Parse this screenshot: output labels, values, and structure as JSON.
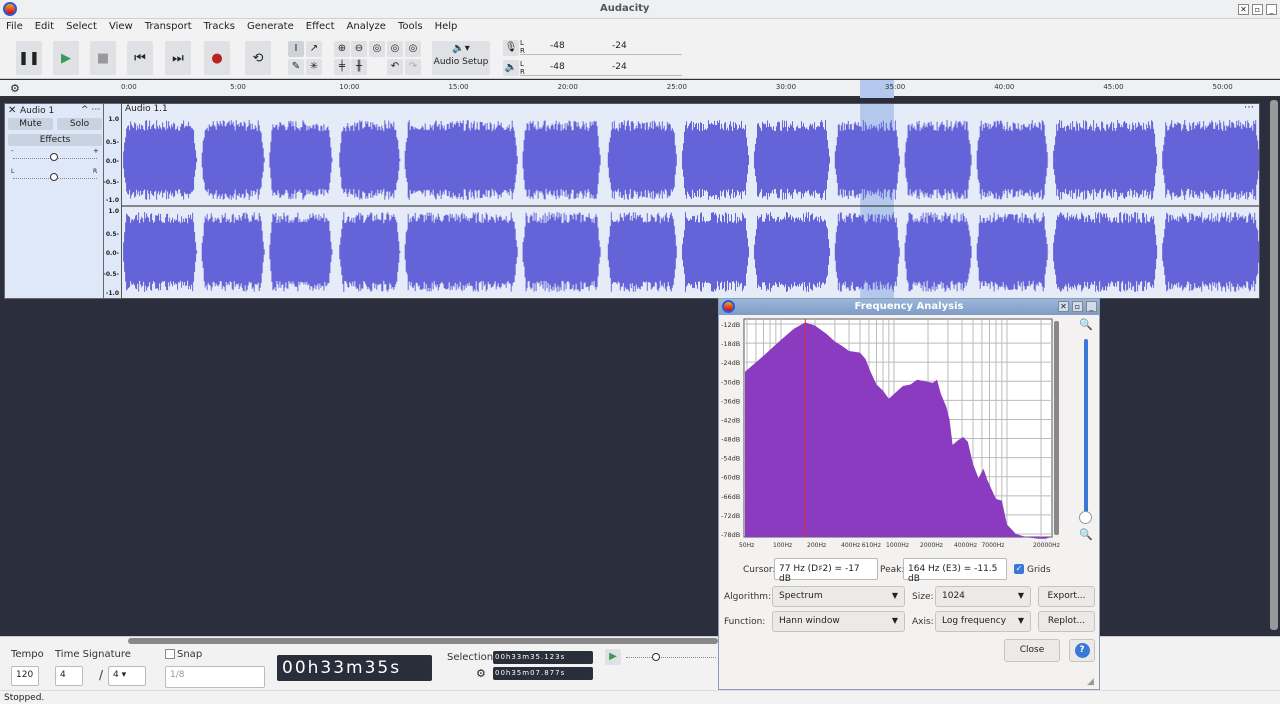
{
  "app": {
    "title": "Audacity"
  },
  "menu": [
    "File",
    "Edit",
    "Select",
    "View",
    "Transport",
    "Tracks",
    "Generate",
    "Effect",
    "Analyze",
    "Tools",
    "Help"
  ],
  "toolbar": {
    "audio_setup": "Audio Setup",
    "meter_rec": {
      "l": "L",
      "r": "R",
      "ticks": [
        "-48",
        "-24"
      ]
    },
    "meter_play": {
      "l": "L",
      "r": "R",
      "ticks": [
        "-48",
        "-24"
      ]
    }
  },
  "ruler": {
    "labels": [
      "0:00",
      "5:00",
      "10:00",
      "15:00",
      "20:00",
      "25:00",
      "30:00",
      "35:00",
      "40:00",
      "45:00",
      "50:00"
    ]
  },
  "track": {
    "name": "Audio 1",
    "clip_name": "Audio 1.1",
    "mute": "Mute",
    "solo": "Solo",
    "effects": "Effects",
    "gain_minus": "-",
    "gain_plus": "+",
    "pan_l": "L",
    "pan_r": "R",
    "scale": [
      "1.0",
      "0.5-",
      "0.0-",
      "-0.5-",
      "-1.0"
    ],
    "selection_min": [
      33.585,
      35.131
    ],
    "clips_min": [
      [
        -0.2,
        3.2
      ],
      [
        3.4,
        6.3
      ],
      [
        6.5,
        9.4
      ],
      [
        9.7,
        12.5
      ],
      [
        12.7,
        17.9
      ],
      [
        18.1,
        21.7
      ],
      [
        22.0,
        25.2
      ],
      [
        25.4,
        28.5
      ],
      [
        28.7,
        32.2
      ],
      [
        32.4,
        35.4
      ],
      [
        35.6,
        38.7
      ],
      [
        38.9,
        42.2
      ],
      [
        42.4,
        47.2
      ],
      [
        47.4,
        51.9
      ]
    ]
  },
  "bottom": {
    "tempo_label": "Tempo",
    "tempo": "120",
    "timesig_label": "Time Signature",
    "ts_num": "4",
    "ts_sep": "/",
    "ts_den": "4",
    "snap_label": "Snap",
    "snap_value": "1/8",
    "time": "00h33m35s",
    "selection_label": "Selection",
    "sel_start": "00h33m35.123s",
    "sel_end": "00h35m07.877s"
  },
  "status": "Stopped.",
  "dialog": {
    "title": "Frequency Analysis",
    "db_labels": [
      "-12dB",
      "-18dB",
      "-24dB",
      "-30dB",
      "-36dB",
      "-42dB",
      "-48dB",
      "-54dB",
      "-60dB",
      "-66dB",
      "-72dB",
      "-78dB"
    ],
    "freq_labels": [
      [
        "50Hz",
        50
      ],
      [
        "100Hz",
        100
      ],
      [
        "200Hz",
        200
      ],
      [
        "400Hz",
        400
      ],
      [
        "610Hz",
        610
      ],
      [
        "1000Hz",
        1000
      ],
      [
        "2000Hz",
        2000
      ],
      [
        "4000Hz",
        4000
      ],
      [
        "7000Hz",
        7000
      ],
      [
        "20000Hz",
        20000
      ]
    ],
    "spectrum": [
      [
        46,
        -27
      ],
      [
        70,
        -22
      ],
      [
        100,
        -17
      ],
      [
        130,
        -13.5
      ],
      [
        164,
        -11.5
      ],
      [
        200,
        -12.5
      ],
      [
        250,
        -15
      ],
      [
        300,
        -17.5
      ],
      [
        350,
        -19
      ],
      [
        400,
        -20.5
      ],
      [
        500,
        -21
      ],
      [
        560,
        -23
      ],
      [
        620,
        -27
      ],
      [
        700,
        -31
      ],
      [
        800,
        -33
      ],
      [
        900,
        -35.5
      ],
      [
        1000,
        -34
      ],
      [
        1200,
        -31.5
      ],
      [
        1400,
        -31
      ],
      [
        1600,
        -29.5
      ],
      [
        1900,
        -30
      ],
      [
        2200,
        -30.5
      ],
      [
        2400,
        -29.5
      ],
      [
        2600,
        -34
      ],
      [
        2900,
        -38
      ],
      [
        3100,
        -42
      ],
      [
        3300,
        -50
      ],
      [
        3700,
        -48.5
      ],
      [
        4100,
        -47.5
      ],
      [
        4500,
        -49
      ],
      [
        5000,
        -56
      ],
      [
        5600,
        -60.5
      ],
      [
        6200,
        -57.5
      ],
      [
        6700,
        -61
      ],
      [
        7300,
        -64
      ],
      [
        8000,
        -67
      ],
      [
        9000,
        -67.5
      ],
      [
        10000,
        -75
      ],
      [
        12000,
        -78
      ],
      [
        15000,
        -79
      ],
      [
        19000,
        -79.5
      ],
      [
        22000,
        -79.5
      ]
    ],
    "peak_hz": 164,
    "cursor_label": "Cursor:",
    "cursor_value": "77 Hz (D♯2) = -17 dB",
    "peak_label": "Peak:",
    "peak_value": "164 Hz (E3) = -11.5 dB",
    "grids_label": "Grids",
    "algorithm_label": "Algorithm:",
    "algorithm": "Spectrum",
    "size_label": "Size:",
    "size": "1024",
    "export": "Export...",
    "function_label": "Function:",
    "function": "Hann window",
    "axis_label": "Axis:",
    "axis": "Log frequency",
    "replot": "Replot...",
    "close": "Close",
    "help": "?"
  },
  "colors": {
    "waveform": "#6464d8",
    "spectrum": "#8a3bbf",
    "selection": "#b4c8ee",
    "peak_line": "#e0303a"
  }
}
